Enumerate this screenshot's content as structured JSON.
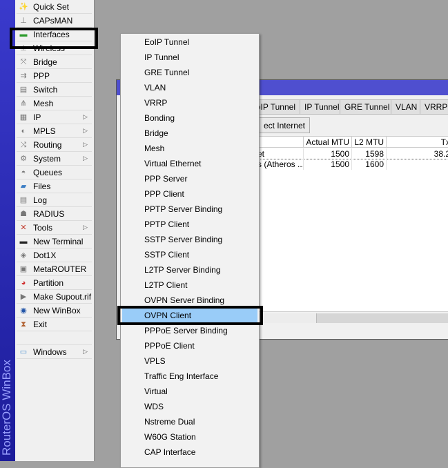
{
  "branding": {
    "vertical_title": "RouterOS WinBox"
  },
  "sidebar": {
    "items": [
      {
        "label": "Quick Set",
        "icon": "wand-icon",
        "submenu": false
      },
      {
        "label": "CAPsMAN",
        "icon": "antenna-icon",
        "submenu": false
      },
      {
        "label": "Interfaces",
        "icon": "network-card-icon",
        "submenu": false,
        "highlighted": true
      },
      {
        "label": "Wireless",
        "icon": "wireless-icon",
        "submenu": false
      },
      {
        "label": "Bridge",
        "icon": "bridge-icon",
        "submenu": false
      },
      {
        "label": "PPP",
        "icon": "ppp-icon",
        "submenu": false
      },
      {
        "label": "Switch",
        "icon": "switch-icon",
        "submenu": false
      },
      {
        "label": "Mesh",
        "icon": "mesh-icon",
        "submenu": false
      },
      {
        "label": "IP",
        "icon": "ip-icon",
        "submenu": true
      },
      {
        "label": "MPLS",
        "icon": "mpls-icon",
        "submenu": true
      },
      {
        "label": "Routing",
        "icon": "routing-icon",
        "submenu": true
      },
      {
        "label": "System",
        "icon": "gear-icon",
        "submenu": true
      },
      {
        "label": "Queues",
        "icon": "queues-icon",
        "submenu": false
      },
      {
        "label": "Files",
        "icon": "folder-icon",
        "submenu": false
      },
      {
        "label": "Log",
        "icon": "log-icon",
        "submenu": false
      },
      {
        "label": "RADIUS",
        "icon": "users-key-icon",
        "submenu": false
      },
      {
        "label": "Tools",
        "icon": "tools-icon",
        "submenu": true
      },
      {
        "label": "New Terminal",
        "icon": "terminal-icon",
        "submenu": false
      },
      {
        "label": "Dot1X",
        "icon": "dot1x-icon",
        "submenu": false
      },
      {
        "label": "MetaROUTER",
        "icon": "monitor-icon",
        "submenu": false
      },
      {
        "label": "Partition",
        "icon": "pie-icon",
        "submenu": false
      },
      {
        "label": "Make Supout.rif",
        "icon": "file-icon",
        "submenu": false
      },
      {
        "label": "New WinBox",
        "icon": "winbox-icon",
        "submenu": false
      },
      {
        "label": "Exit",
        "icon": "exit-icon",
        "submenu": false
      },
      {
        "label": "",
        "icon": "",
        "submenu": false
      },
      {
        "label": "Windows",
        "icon": "window-icon",
        "submenu": true
      }
    ]
  },
  "window": {
    "tabs": [
      "EoIP Tunnel",
      "IP Tunnel",
      "GRE Tunnel",
      "VLAN",
      "VRRP"
    ],
    "button": "ect Internet",
    "columns": [
      "",
      "Actual MTU",
      "L2 MTU",
      "Tx"
    ],
    "rows": [
      [
        "et",
        "1500",
        "1598",
        "38.2"
      ],
      [
        "s (Atheros ...",
        "1500",
        "1600",
        ""
      ]
    ]
  },
  "dropdown": {
    "selected": "OVPN Client",
    "items": [
      "EoIP Tunnel",
      "IP Tunnel",
      "GRE Tunnel",
      "VLAN",
      "VRRP",
      "Bonding",
      "Bridge",
      "Mesh",
      "Virtual Ethernet",
      "PPP Server",
      "PPP Client",
      "PPTP Server Binding",
      "PPTP Client",
      "SSTP Server Binding",
      "SSTP Client",
      "L2TP Server Binding",
      "L2TP Client",
      "OVPN Server Binding",
      "OVPN Client",
      "PPPoE Server Binding",
      "PPPoE Client",
      "VPLS",
      "Traffic Eng Interface",
      "Virtual",
      "WDS",
      "Nstreme Dual",
      "W60G Station",
      "CAP Interface"
    ]
  },
  "colors": {
    "title_bar": "#4f4fcf",
    "selection": "#99ccf8",
    "strip": "#2a2ab8"
  }
}
